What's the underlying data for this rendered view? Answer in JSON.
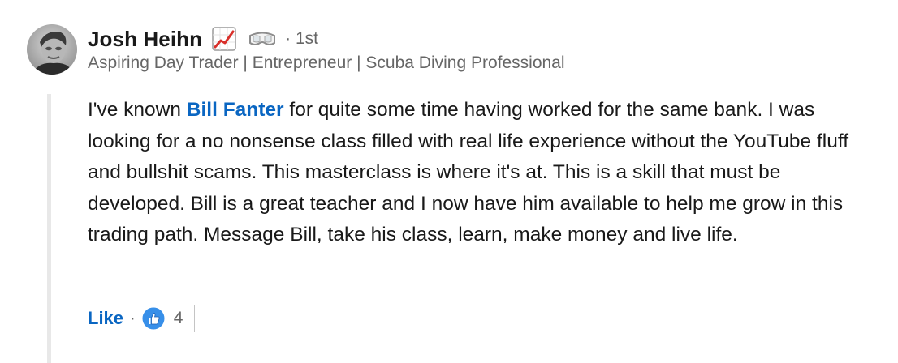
{
  "author": {
    "name": "Josh Heihn",
    "name_emojis": [
      "chart-increasing-icon",
      "goggles-icon"
    ],
    "separator": "·",
    "degree": "1st",
    "headline": "Aspiring Day Trader | Entrepreneur | Scuba Diving Professional"
  },
  "comment": {
    "text_before_mention": "I've known ",
    "mention": "Bill Fanter",
    "text_after_mention": " for quite some time having worked for the same bank. I was looking for a no nonsense class filled with real life experience without the YouTube fluff and bullshit scams. This masterclass is where it's at. This is a skill that must be developed. Bill is a great teacher and I now have him available to help me grow in this trading path. Message Bill, take his class, learn, make money and live life."
  },
  "actions": {
    "like_label": "Like",
    "separator": "·",
    "reaction_icon": "thumbs-up-icon",
    "reaction_count": "4"
  },
  "colors": {
    "link_blue": "#0a66c2",
    "text_primary": "#191919",
    "text_secondary": "#666666",
    "thread_line": "#e8e8e8"
  }
}
